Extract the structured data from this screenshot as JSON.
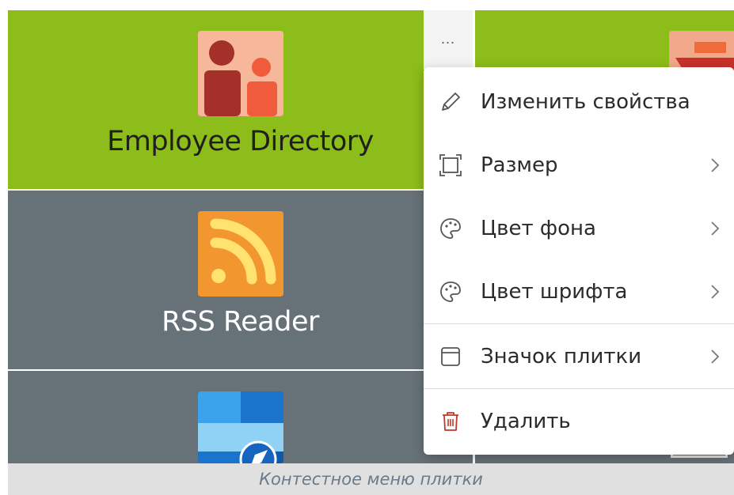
{
  "tiles": {
    "employee_directory": "Employee Directory",
    "rss_reader": "RSS Reader"
  },
  "tile_menu": {
    "more_button": "...",
    "items": [
      {
        "label": "Изменить свойства",
        "icon": "pencil-icon",
        "has_submenu": false
      },
      {
        "label": "Размер",
        "icon": "resize-icon",
        "has_submenu": true
      },
      {
        "label": "Цвет фона",
        "icon": "palette-icon",
        "has_submenu": true
      },
      {
        "label": "Цвет шрифта",
        "icon": "palette-icon",
        "has_submenu": true
      },
      {
        "label": "Значок плитки",
        "icon": "tile-icon",
        "has_submenu": true
      },
      {
        "label": "Удалить",
        "icon": "trash-icon",
        "has_submenu": false
      }
    ]
  },
  "caption": "Контестное меню плитки",
  "colors": {
    "tile_green": "#8cbd1a",
    "tile_gray": "#677278",
    "delete_red": "#c0392b"
  }
}
